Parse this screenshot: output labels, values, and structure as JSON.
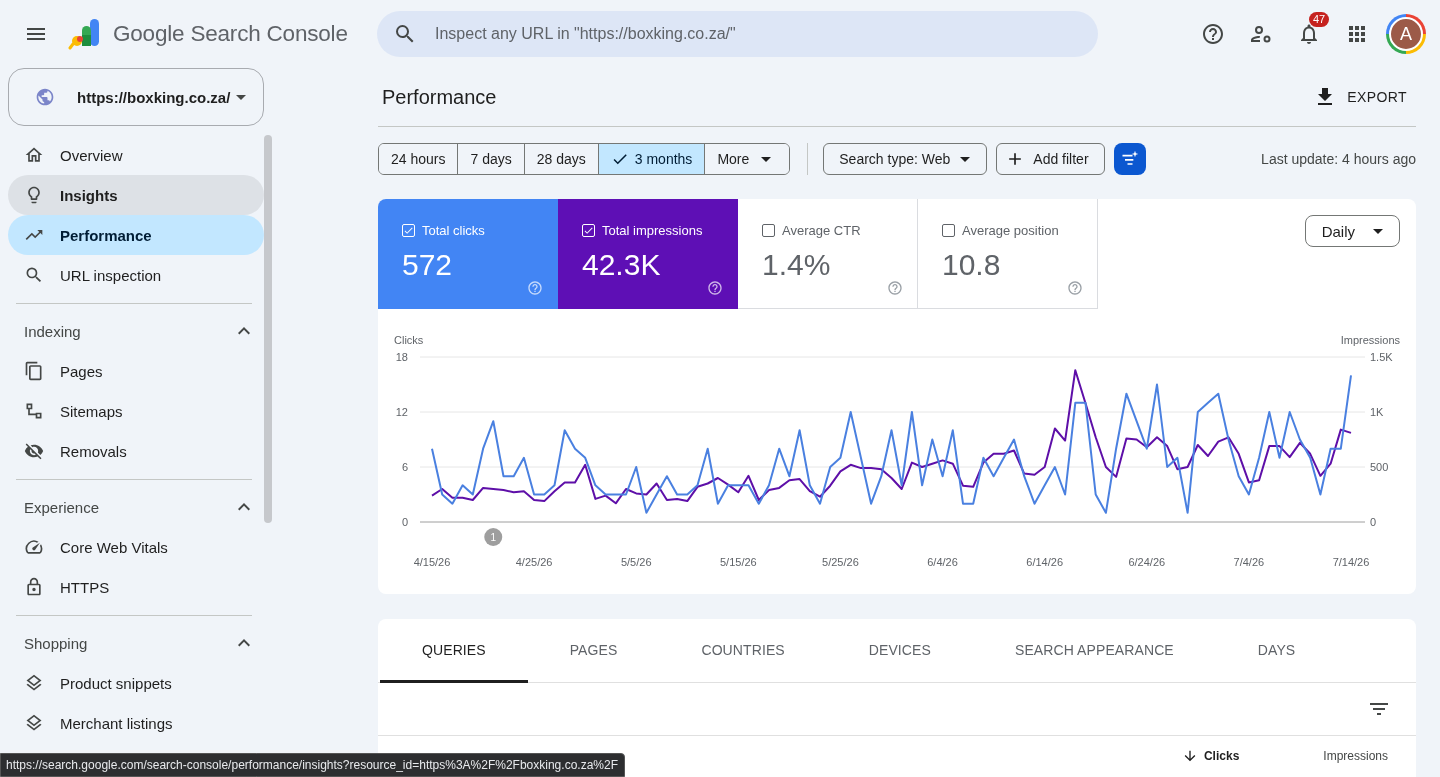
{
  "header": {
    "app_name": "Google Search Console",
    "search": {
      "placeholder": "Inspect any URL in \"https://boxking.co.za/\""
    },
    "notifications_badge": "47",
    "avatar": "A"
  },
  "property": {
    "url": "https://boxking.co.za/"
  },
  "sidebar": {
    "top_items": [
      {
        "label": "Overview",
        "selected": false,
        "hovered": false
      },
      {
        "label": "Insights",
        "selected": false,
        "hovered": true
      },
      {
        "label": "Performance",
        "selected": true,
        "hovered": false
      },
      {
        "label": "URL inspection",
        "selected": false,
        "hovered": false
      }
    ],
    "sections": [
      {
        "title": "Indexing",
        "expanded": true,
        "items": [
          {
            "label": "Pages",
            "selected": false
          },
          {
            "label": "Sitemaps",
            "selected": false
          },
          {
            "label": "Removals",
            "selected": false
          }
        ]
      },
      {
        "title": "Experience",
        "expanded": true,
        "items": [
          {
            "label": "Core Web Vitals",
            "selected": false
          },
          {
            "label": "HTTPS",
            "selected": false
          }
        ]
      },
      {
        "title": "Shopping",
        "expanded": true,
        "items": [
          {
            "label": "Product snippets",
            "selected": false
          },
          {
            "label": "Merchant listings",
            "selected": false
          }
        ]
      }
    ]
  },
  "main": {
    "title": "Performance",
    "export_label": "EXPORT",
    "date_ranges": [
      {
        "label": "24 hours",
        "selected": false
      },
      {
        "label": "7 days",
        "selected": false
      },
      {
        "label": "28 days",
        "selected": false
      },
      {
        "label": "3 months",
        "selected": true
      }
    ],
    "more_label": "More",
    "search_type": "Search type: Web",
    "add_filter": "Add filter",
    "last_update": "Last update: 4 hours ago",
    "metrics": [
      {
        "label": "Total clicks",
        "value": "572",
        "checked": true,
        "color": "#4285f4"
      },
      {
        "label": "Total impressions",
        "value": "42.3K",
        "checked": true,
        "color": "#5e0fb5"
      },
      {
        "label": "Average CTR",
        "value": "1.4%",
        "checked": false
      },
      {
        "label": "Average position",
        "value": "10.8",
        "checked": false
      }
    ],
    "granularity": "Daily",
    "chart_data": {
      "type": "line",
      "ylabel": "Clicks",
      "y2label": "Impressions",
      "categories": [
        "4/15/26",
        null,
        null,
        null,
        null,
        null,
        null,
        null,
        null,
        null,
        "4/25/26",
        null,
        null,
        null,
        null,
        null,
        null,
        null,
        null,
        null,
        "5/5/26",
        null,
        null,
        null,
        null,
        null,
        null,
        null,
        null,
        null,
        "5/15/26",
        null,
        null,
        null,
        null,
        null,
        null,
        null,
        null,
        null,
        "5/25/26",
        null,
        null,
        null,
        null,
        null,
        null,
        null,
        null,
        null,
        "6/4/26",
        null,
        null,
        null,
        null,
        null,
        null,
        null,
        null,
        null,
        "6/14/26",
        null,
        null,
        null,
        null,
        null,
        null,
        null,
        null,
        null,
        "6/24/26",
        null,
        null,
        null,
        null,
        null,
        null,
        null,
        null,
        null,
        "7/4/26",
        null,
        null,
        null,
        null,
        null,
        null,
        null,
        null,
        null,
        "7/14/26"
      ],
      "ylim": [
        0,
        18
      ],
      "y2lim": [
        0,
        1500
      ],
      "yticks": [
        0,
        6,
        12,
        18
      ],
      "y2ticks": [
        0,
        500,
        {
          "value": 1000,
          "label": "1K"
        },
        {
          "value": 1500,
          "label": "1.5K"
        }
      ],
      "series": [
        {
          "color": "#4a80e0",
          "values": [
            8,
            3,
            2,
            4,
            3,
            8,
            11,
            5,
            5,
            7,
            3,
            3,
            4,
            10,
            8,
            7,
            4,
            3,
            3,
            3,
            6,
            1,
            3,
            5,
            3,
            3,
            4,
            8,
            2,
            4,
            4,
            4,
            2,
            4,
            8,
            5,
            10,
            4,
            2,
            6,
            7,
            12,
            7,
            2,
            5,
            10,
            4,
            12,
            4,
            9,
            5,
            10,
            2,
            2,
            7,
            5,
            7,
            9,
            5,
            2,
            4,
            6,
            3,
            13,
            13,
            3,
            1,
            8,
            14,
            11,
            8,
            15,
            6,
            7,
            1,
            12,
            13,
            14,
            9,
            5,
            3,
            7,
            12,
            7,
            12,
            9,
            7,
            3,
            8,
            8,
            16
          ]
        },
        {
          "color": "#5e0fa8",
          "axis": "y2",
          "values": [
            240,
            300,
            220,
            220,
            200,
            310,
            300,
            290,
            270,
            280,
            200,
            190,
            280,
            360,
            360,
            520,
            210,
            240,
            170,
            300,
            260,
            250,
            350,
            200,
            210,
            190,
            320,
            350,
            400,
            340,
            270,
            420,
            200,
            290,
            310,
            380,
            390,
            280,
            230,
            330,
            460,
            520,
            490,
            490,
            480,
            400,
            300,
            540,
            500,
            530,
            560,
            530,
            330,
            320,
            540,
            620,
            620,
            650,
            440,
            430,
            500,
            850,
            740,
            1380,
            1080,
            770,
            500,
            410,
            760,
            750,
            680,
            770,
            690,
            480,
            500,
            700,
            600,
            730,
            770,
            620,
            360,
            380,
            690,
            690,
            590,
            720,
            620,
            420,
            530,
            840,
            810
          ]
        }
      ],
      "annotations": [
        "1"
      ]
    },
    "tabs": [
      {
        "label": "QUERIES",
        "selected": true
      },
      {
        "label": "PAGES",
        "selected": false
      },
      {
        "label": "COUNTRIES",
        "selected": false
      },
      {
        "label": "DEVICES",
        "selected": false
      },
      {
        "label": "SEARCH APPEARANCE",
        "selected": false
      },
      {
        "label": "DAYS",
        "selected": false
      }
    ],
    "table": {
      "columns": [
        {
          "label": "Clicks",
          "sorted": true
        },
        {
          "label": "Impressions",
          "sorted": false
        }
      ]
    }
  },
  "status_bar": {
    "url": "https://search.google.com/search-console/performance/insights?resource_id=https%3A%2F%2Fboxking.co.za%2F"
  }
}
